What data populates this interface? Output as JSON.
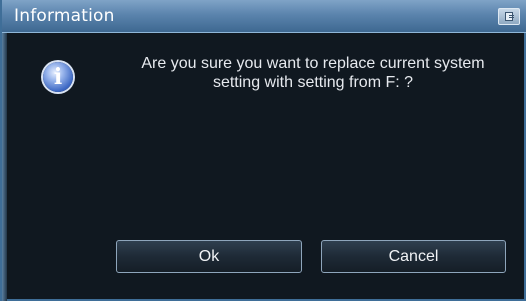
{
  "window": {
    "title": "Information"
  },
  "dialog": {
    "message_line1": "Are you sure you want to replace current system",
    "message_line2": "setting with setting from F: ?",
    "icon": "info-icon",
    "ok_label": "Ok",
    "cancel_label": "Cancel"
  },
  "colors": {
    "titlebar": "#5b84ad",
    "background": "#101820",
    "button_border": "#8ea5bb"
  }
}
